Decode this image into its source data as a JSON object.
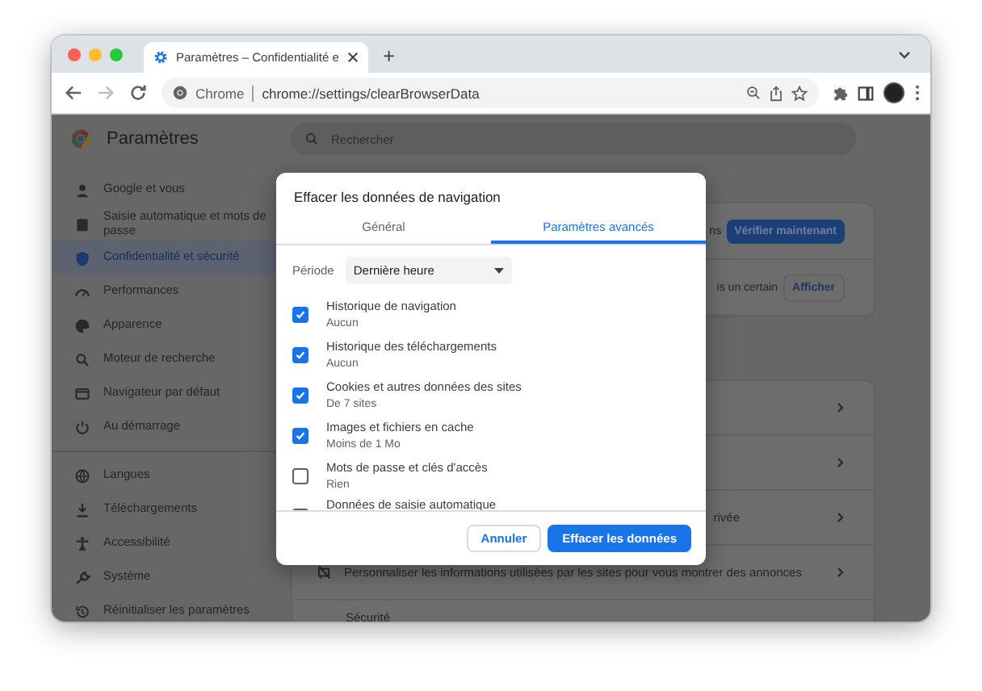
{
  "browser_tab": {
    "title": "Paramètres – Confidentialité e",
    "new_tab": "+"
  },
  "toolbar": {
    "nav_buttons": [
      {
        "kind": "back",
        "disabled": false
      },
      {
        "kind": "forward",
        "disabled": true
      },
      {
        "kind": "reload",
        "disabled": false
      }
    ],
    "site_label": "Chrome",
    "url": "chrome://settings/clearBrowserData"
  },
  "settings": {
    "title": "Paramètres",
    "search": {
      "placeholder": "Rechercher"
    },
    "sidebar": {
      "groups": [
        [
          {
            "label": "Google et vous",
            "selected": false
          },
          {
            "label": "Saisie automatique et mots de passe",
            "selected": false
          },
          {
            "label": "Confidentialité et sécurité",
            "selected": true
          },
          {
            "label": "Performances",
            "selected": false
          },
          {
            "label": "Apparence",
            "selected": false
          },
          {
            "label": "Moteur de recherche",
            "selected": false
          },
          {
            "label": "Navigateur par défaut",
            "selected": false
          },
          {
            "label": "Au démarrage",
            "selected": false
          }
        ],
        [
          {
            "label": "Langues",
            "selected": false
          },
          {
            "label": "Téléchargements",
            "selected": false
          },
          {
            "label": "Accessibilité",
            "selected": false
          },
          {
            "label": "Système",
            "selected": false
          },
          {
            "label": "Réinitialiser les paramètres",
            "selected": false
          }
        ]
      ]
    },
    "safety_card": {
      "rows": [
        {
          "text": "ns",
          "button": "Vérifier maintenant",
          "primary": true
        },
        {
          "text": "is un certain",
          "button": "Afficher",
          "primary": false
        }
      ]
    },
    "privacy_card": {
      "rows": [
        {
          "text": ""
        },
        {
          "text": ""
        },
        {
          "text": "rivée"
        },
        {
          "text": "Personnaliser les informations utilisées par les sites pour vous montrer des annonces"
        }
      ],
      "footer": "Sécurité"
    }
  },
  "dialog": {
    "title": "Effacer les données de navigation",
    "tabs": [
      {
        "label": "Général",
        "selected": false
      },
      {
        "label": "Paramètres avancés",
        "selected": true
      }
    ],
    "period": {
      "label": "Période",
      "value": "Dernière heure"
    },
    "items": [
      {
        "label": "Historique de navigation",
        "detail": "Aucun",
        "checked": true
      },
      {
        "label": "Historique des téléchargements",
        "detail": "Aucun",
        "checked": true
      },
      {
        "label": "Cookies et autres données des sites",
        "detail": "De 7 sites",
        "checked": true
      },
      {
        "label": "Images et fichiers en cache",
        "detail": "Moins de 1 Mo",
        "checked": true
      },
      {
        "label": "Mots de passe et clés d'accès",
        "detail": "Rien",
        "checked": false
      },
      {
        "label": "Données de saisie automatique",
        "checked": false
      }
    ],
    "buttons": [
      {
        "label": "Annuler",
        "primary": false
      },
      {
        "label": "Effacer les données",
        "primary": true
      }
    ]
  }
}
